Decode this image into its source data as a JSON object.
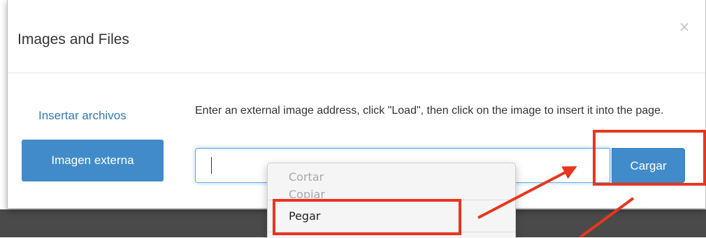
{
  "dialog": {
    "title": "Images and Files",
    "close_glyph": "×"
  },
  "sidebar": {
    "link_label": "Insertar archivos",
    "button_label": "Imagen externa"
  },
  "main": {
    "instructions": "Enter an external image address, click \"Load\", then click on the image to insert it into the page.",
    "url_input": {
      "value": "",
      "placeholder": ""
    },
    "load_button_label": "Cargar"
  },
  "context_menu": {
    "items": [
      {
        "label": "Cortar",
        "enabled": false
      },
      {
        "label": "Copiar",
        "enabled": false
      },
      {
        "label": "Pegar",
        "enabled": true
      }
    ]
  },
  "colors": {
    "primary": "#428bca",
    "link": "#337ab7",
    "annotation": "#e8361e",
    "backdrop": "#4a4a4a"
  },
  "icons": [
    "close-icon",
    "text-caret",
    "arrow-annotation"
  ]
}
